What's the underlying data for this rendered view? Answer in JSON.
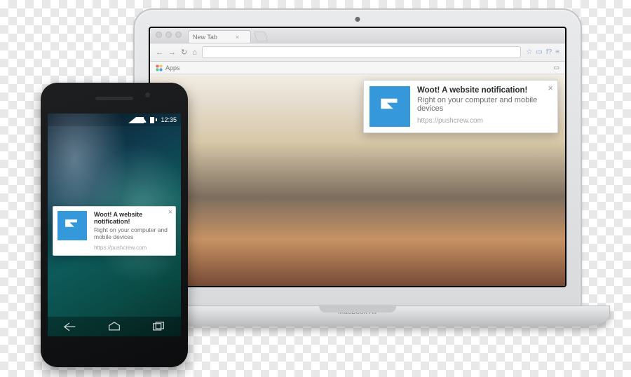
{
  "browser": {
    "tab_label": "New Tab",
    "apps_label": "Apps",
    "toolbar_query": "f?"
  },
  "phone": {
    "clock": "12:35"
  },
  "laptop": {
    "brand": "MacBook Air"
  },
  "notification": {
    "title": "Woot! A website notification!",
    "body": "Right on your computer and mobile devices",
    "url": "https://pushcrew.com"
  }
}
